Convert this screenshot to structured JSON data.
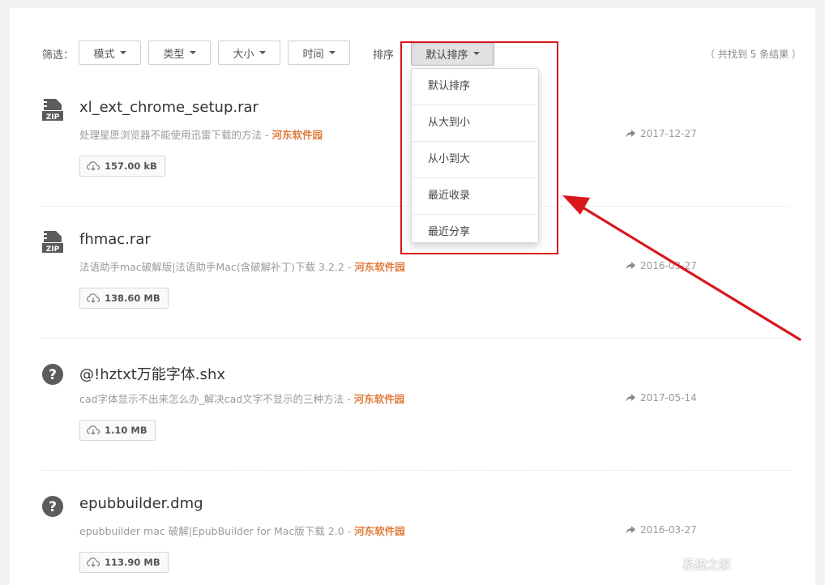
{
  "filter": {
    "label": "筛选：",
    "buttons": [
      "模式",
      "类型",
      "大小",
      "时间"
    ]
  },
  "sort": {
    "label": "排序",
    "current": "默认排序",
    "options": [
      "默认排序",
      "从大到小",
      "从小到大",
      "最近收录",
      "最近分享"
    ]
  },
  "result_count": "（ 共找到 5 条结果 ）",
  "results": [
    {
      "icon": "zip-file-icon",
      "name": "xl_ext_chrome_setup.rar",
      "desc": "处理星愿浏览器不能使用迅雷下载的方法 - ",
      "source": "河东软件园",
      "date": "2017-12-27",
      "size": "157.00 kB"
    },
    {
      "icon": "zip-file-icon",
      "name": "fhmac.rar",
      "desc": "法语助手mac破解版|法语助手Mac(含破解补丁)下载 3.2.2 - ",
      "source": "河东软件园",
      "date": "2016-03-27",
      "size": "138.60 MB"
    },
    {
      "icon": "unknown-file-icon",
      "name": "@!hztxt万能字体.shx",
      "desc": "cad字体显示不出来怎么办_解决cad文字不显示的三种方法 - ",
      "source": "河东软件园",
      "date": "2017-05-14",
      "size": "1.10 MB"
    },
    {
      "icon": "unknown-file-icon",
      "name": "epubbuilder.dmg",
      "desc": "epubbuilder mac 破解|EpubBuilder for Mac版下载 2.0 - ",
      "source": "河东软件园",
      "date": "2016-03-27",
      "size": "113.90 MB"
    }
  ],
  "icons": {
    "caret": "caret-down-icon",
    "share": "share-arrow-icon",
    "cloud": "cloud-download-icon"
  },
  "colors": {
    "source_orange": "#e07a3a",
    "highlight_red": "#d9161c"
  },
  "watermark": "系统之家"
}
